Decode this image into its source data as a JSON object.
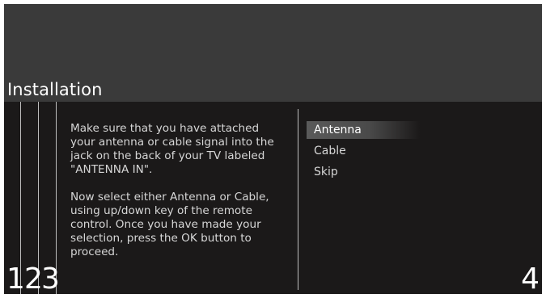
{
  "header": {
    "title": "Installation"
  },
  "steps": {
    "left": [
      "1",
      "2",
      "3"
    ],
    "right": "4"
  },
  "instructions": {
    "paragraph_1": "Make sure that you have attached your antenna or cable signal into the jack on the back of your TV labeled \"ANTENNA IN\".",
    "paragraph_2": "Now select either Antenna or Cable, using up/down key of the remote control. Once you have made your selection, press the OK button to proceed."
  },
  "menu": {
    "selected_index": 0,
    "items": [
      {
        "label": "Antenna"
      },
      {
        "label": "Cable"
      },
      {
        "label": "Skip"
      }
    ]
  },
  "colors": {
    "header_bg": "#3a3a3a",
    "body_bg": "#1b1919",
    "highlight": "#5a5a5a",
    "text": "#ffffff"
  }
}
